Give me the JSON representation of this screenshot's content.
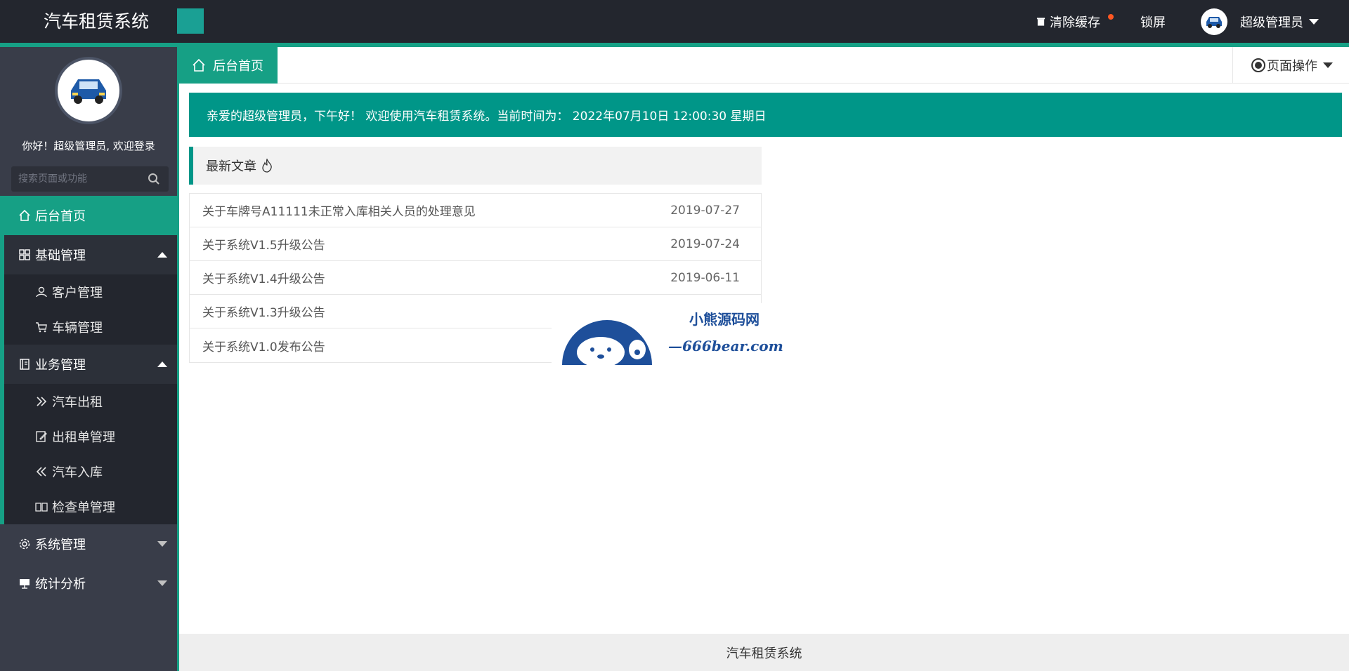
{
  "header": {
    "app_title": "汽车租赁系统",
    "clear_cache": "清除缓存",
    "lock_screen": "锁屏",
    "username": "超级管理员"
  },
  "sidebar": {
    "welcome": "你好！超级管理员, 欢迎登录",
    "search_placeholder": "搜索页面或功能",
    "home": "后台首页",
    "groups": [
      {
        "label": "基础管理",
        "icon": "grid-icon",
        "expanded": true,
        "items": [
          {
            "label": "客户管理",
            "icon": "user-icon"
          },
          {
            "label": "车辆管理",
            "icon": "cart-icon"
          }
        ]
      },
      {
        "label": "业务管理",
        "icon": "book-icon",
        "expanded": true,
        "items": [
          {
            "label": "汽车出租",
            "icon": "double-right-icon"
          },
          {
            "label": "出租单管理",
            "icon": "edit-icon"
          },
          {
            "label": "汽车入库",
            "icon": "double-left-icon"
          },
          {
            "label": "检查单管理",
            "icon": "read-icon"
          }
        ]
      },
      {
        "label": "系统管理",
        "icon": "gear-icon",
        "expanded": false,
        "items": []
      },
      {
        "label": "统计分析",
        "icon": "chart-icon",
        "expanded": false,
        "items": []
      }
    ]
  },
  "tabs": {
    "home": "后台首页",
    "page_ops": "页面操作"
  },
  "greeting": "亲爱的超级管理员，下午好！ 欢迎使用汽车租赁系统。当前时间为： 2022年07月10日 12:00:30 星期日",
  "articles": {
    "title": "最新文章",
    "rows": [
      {
        "title": "关于车牌号A11111未正常入库相关人员的处理意见",
        "date": "2019-07-27"
      },
      {
        "title": "关于系统V1.5升级公告",
        "date": "2019-07-24"
      },
      {
        "title": "关于系统V1.4升级公告",
        "date": "2019-06-11"
      },
      {
        "title": "关于系统V1.3升级公告",
        "date": ""
      },
      {
        "title": "关于系统V1.0发布公告",
        "date": ""
      }
    ]
  },
  "watermark": {
    "name": "小熊源码网",
    "url": "—666bear.com—"
  },
  "footer": "汽车租赁系统",
  "colors": {
    "accent": "#16a085",
    "header_bg": "#23262e",
    "sidebar_bg": "#393d49",
    "greeting_bg": "#009688"
  }
}
